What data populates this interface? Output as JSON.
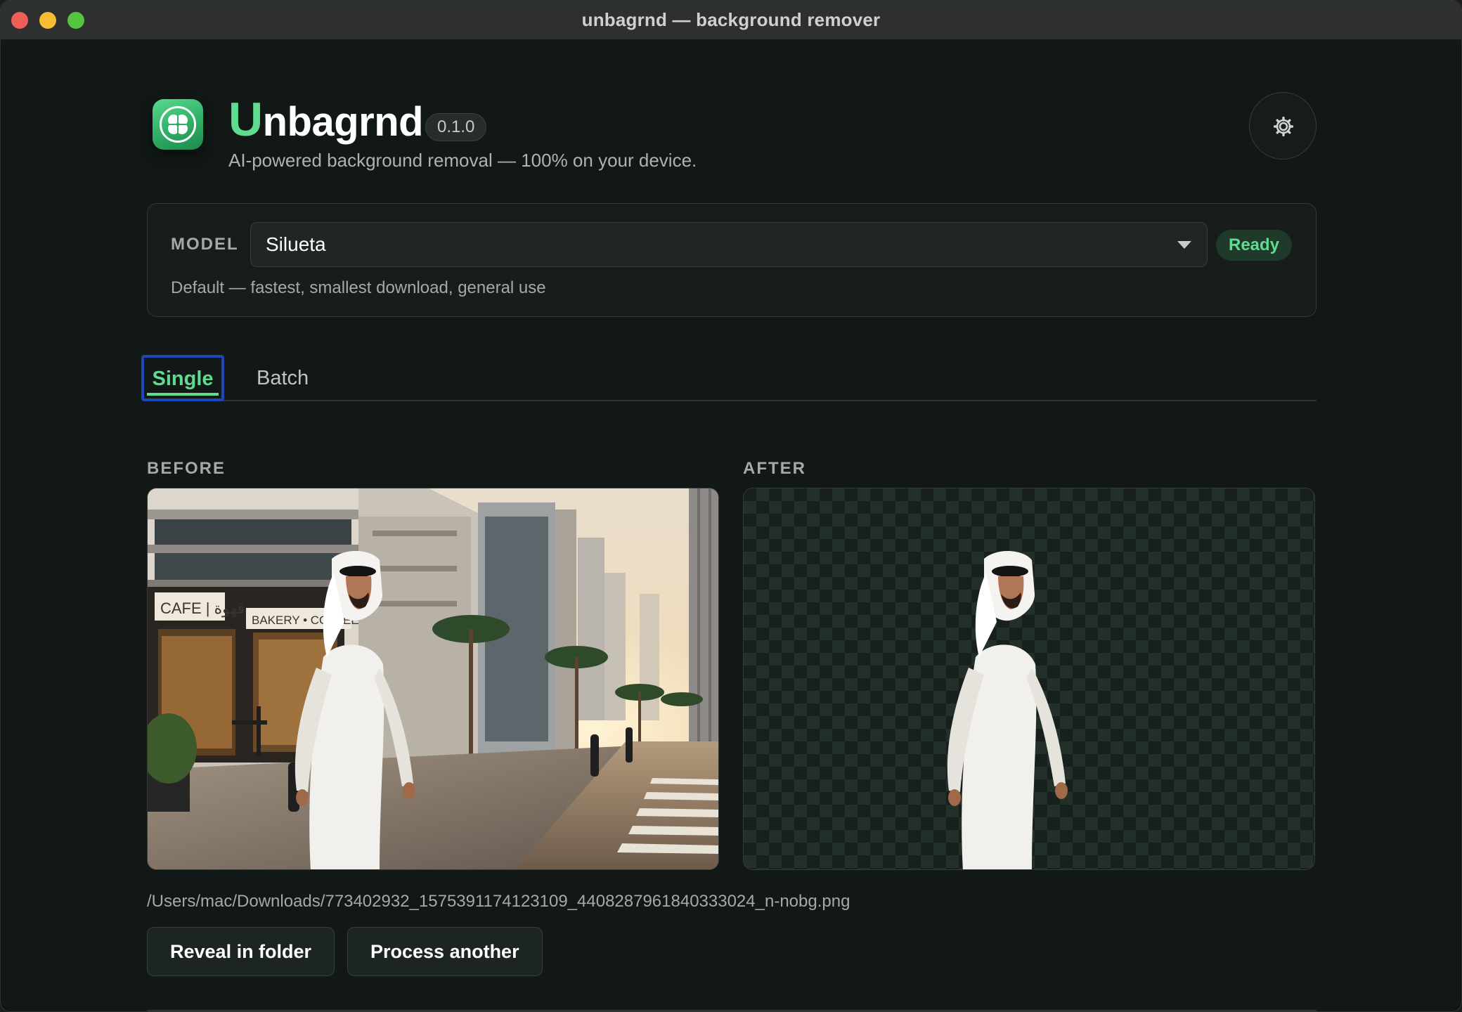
{
  "window": {
    "title": "unbagrnd — background remover"
  },
  "header": {
    "app_name_first_letter": "U",
    "app_name_rest": "nbagrnd",
    "version": "0.1.0",
    "tagline": "AI-powered background removal — 100% on your device.",
    "settings_icon": "gear-icon"
  },
  "model": {
    "label": "MODEL",
    "selected": "Silueta",
    "status": "Ready",
    "description": "Default — fastest, smallest download, general use"
  },
  "tabs": [
    {
      "label": "Single",
      "active": true
    },
    {
      "label": "Batch",
      "active": false
    }
  ],
  "preview": {
    "before_label": "BEFORE",
    "after_label": "AFTER"
  },
  "output": {
    "path": "/Users/mac/Downloads/773402932_1575391174123109_4408287961840333024_n-nobg.png"
  },
  "actions": {
    "reveal_label": "Reveal in folder",
    "process_another_label": "Process another"
  },
  "colors": {
    "accent": "#5fdc8f",
    "background": "#111816",
    "focus_ring": "#1f46b8"
  }
}
